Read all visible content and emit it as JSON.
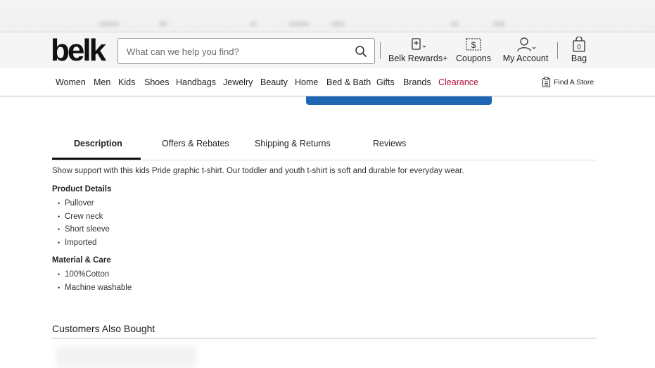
{
  "header": {
    "logo": "belk",
    "search_placeholder": "What can we help you find?",
    "rewards_label": "Belk Rewards+",
    "coupons_label": "Coupons",
    "account_label": "My Account",
    "bag_label": "Bag",
    "bag_count": "0"
  },
  "nav": {
    "items": [
      "Women",
      "Men",
      "Kids",
      "Shoes",
      "Handbags",
      "Jewelry",
      "Beauty",
      "Home",
      "Bed & Bath",
      "Gifts",
      "Brands",
      "Clearance"
    ],
    "find_store": "Find A Store"
  },
  "colors": {
    "clearance": "#b0113a",
    "button_blue": "#1e66b4"
  },
  "tabs": [
    "Description",
    "Offers & Rebates",
    "Shipping & Returns",
    "Reviews"
  ],
  "description": "Show support with this kids Pride graphic t-shirt. Our toddler and youth t-shirt is soft and durable for everyday wear.",
  "product_details": {
    "title": "Product Details",
    "items": [
      "Pullover",
      "Crew neck",
      "Short sleeve",
      "Imported"
    ]
  },
  "material_care": {
    "title": "Material & Care",
    "items": [
      "100%Cotton",
      "Machine washable"
    ]
  },
  "customers_also_bought": "Customers Also Bought"
}
